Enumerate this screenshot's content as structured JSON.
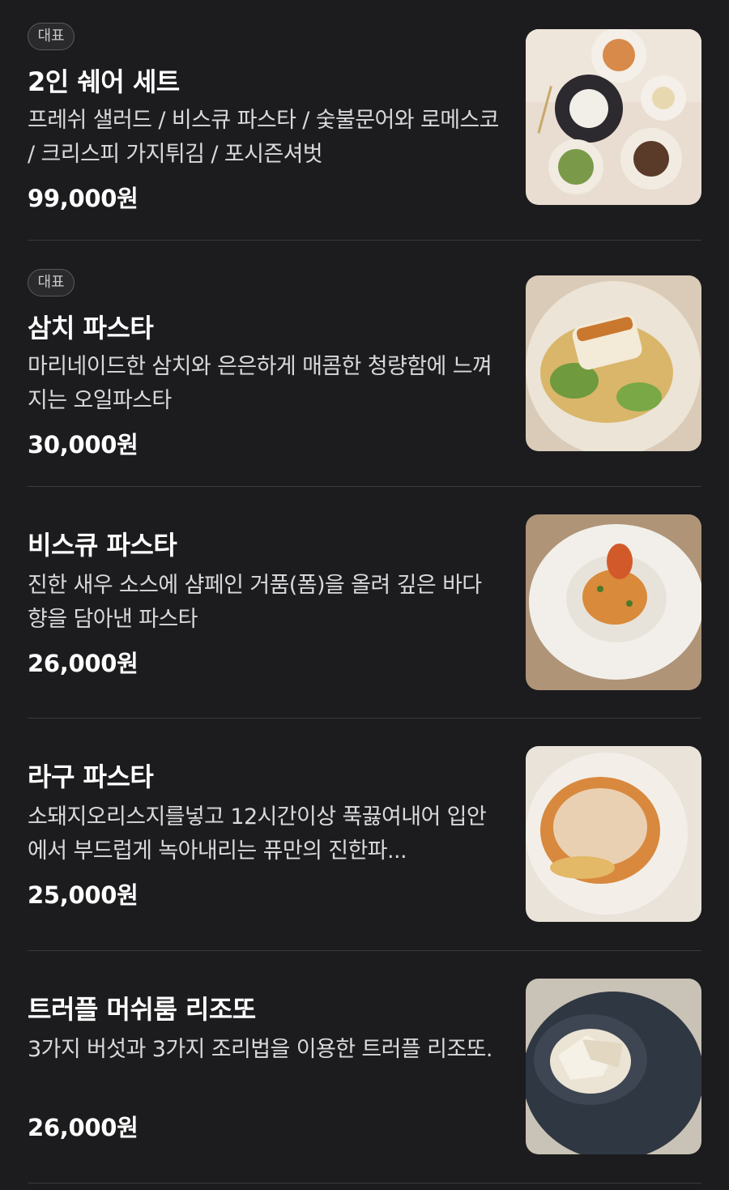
{
  "menu": {
    "items": [
      {
        "badge": "대표",
        "name": "2인 쉐어 세트",
        "description": "프레쉬 샐러드 / 비스큐 파스타 / 숯불문어와 로메스코 / 크리스피 가지튀김 / 포시즌셔벗",
        "price": "99,000원",
        "image": "share-set-photo"
      },
      {
        "badge": "대표",
        "name": "삼치 파스타",
        "description": "마리네이드한 삼치와 은은하게 매콤한 청량함에 느껴지는 오일파스타",
        "price": "30,000원",
        "image": "mackerel-pasta-photo"
      },
      {
        "name": "비스큐 파스타",
        "description": "진한 새우 소스에 샴페인 거품(폼)을 올려 깊은 바다 향을 담아낸 파스타",
        "price": "26,000원",
        "image": "bisque-pasta-photo"
      },
      {
        "name": "라구 파스타",
        "description": "소돼지오리스지를넣고 12시간이상 푹끓여내어 입안에서 부드럽게 녹아내리는 퓨만의 진한파...",
        "price": "25,000원",
        "image": "ragu-pasta-photo"
      },
      {
        "name": "트러플 머쉬룸 리조또",
        "description": "3가지 버섯과 3가지 조리법을 이용한 트러플 리조또.",
        "price": "26,000원",
        "image": "truffle-risotto-photo"
      }
    ]
  }
}
